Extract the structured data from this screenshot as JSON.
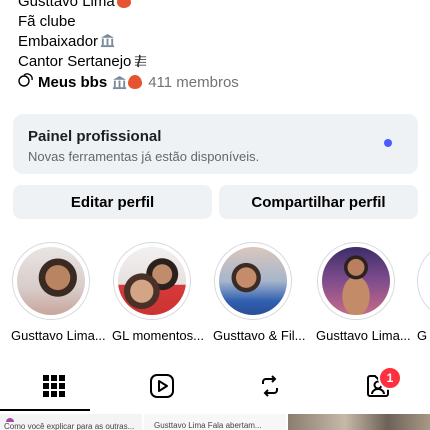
{
  "bio": {
    "line1": "Gusttavo Lima",
    "line2": "Fã clube",
    "line3": "Embaixador",
    "line4": "Cantor Sertanejo"
  },
  "channel": {
    "name": "Meus bbs",
    "members": "411 membros"
  },
  "panel": {
    "title": "Painel profissional",
    "subtitle": "Novas ferramentas já estão disponíveis.",
    "dot_color": "#4a5cff"
  },
  "buttons": {
    "edit": "Editar perfil",
    "share": "Compartilhar perfil"
  },
  "highlights": [
    {
      "label": "Gusttavo Lima..."
    },
    {
      "label": "GL momentos..."
    },
    {
      "label": "Gusttavo & Fil..."
    },
    {
      "label": "Gusttavo Lima..."
    },
    {
      "label": "G"
    }
  ],
  "tabs": {
    "grid": "grid-icon",
    "reels": "reels-icon",
    "reposts": "repost-icon",
    "tagged": "tagged-icon",
    "tagged_badge": "1"
  },
  "posts_preview": {
    "p1": "Como você explicar para as outras...",
    "p2": "Gusttavo Lima Fala abertam..."
  }
}
